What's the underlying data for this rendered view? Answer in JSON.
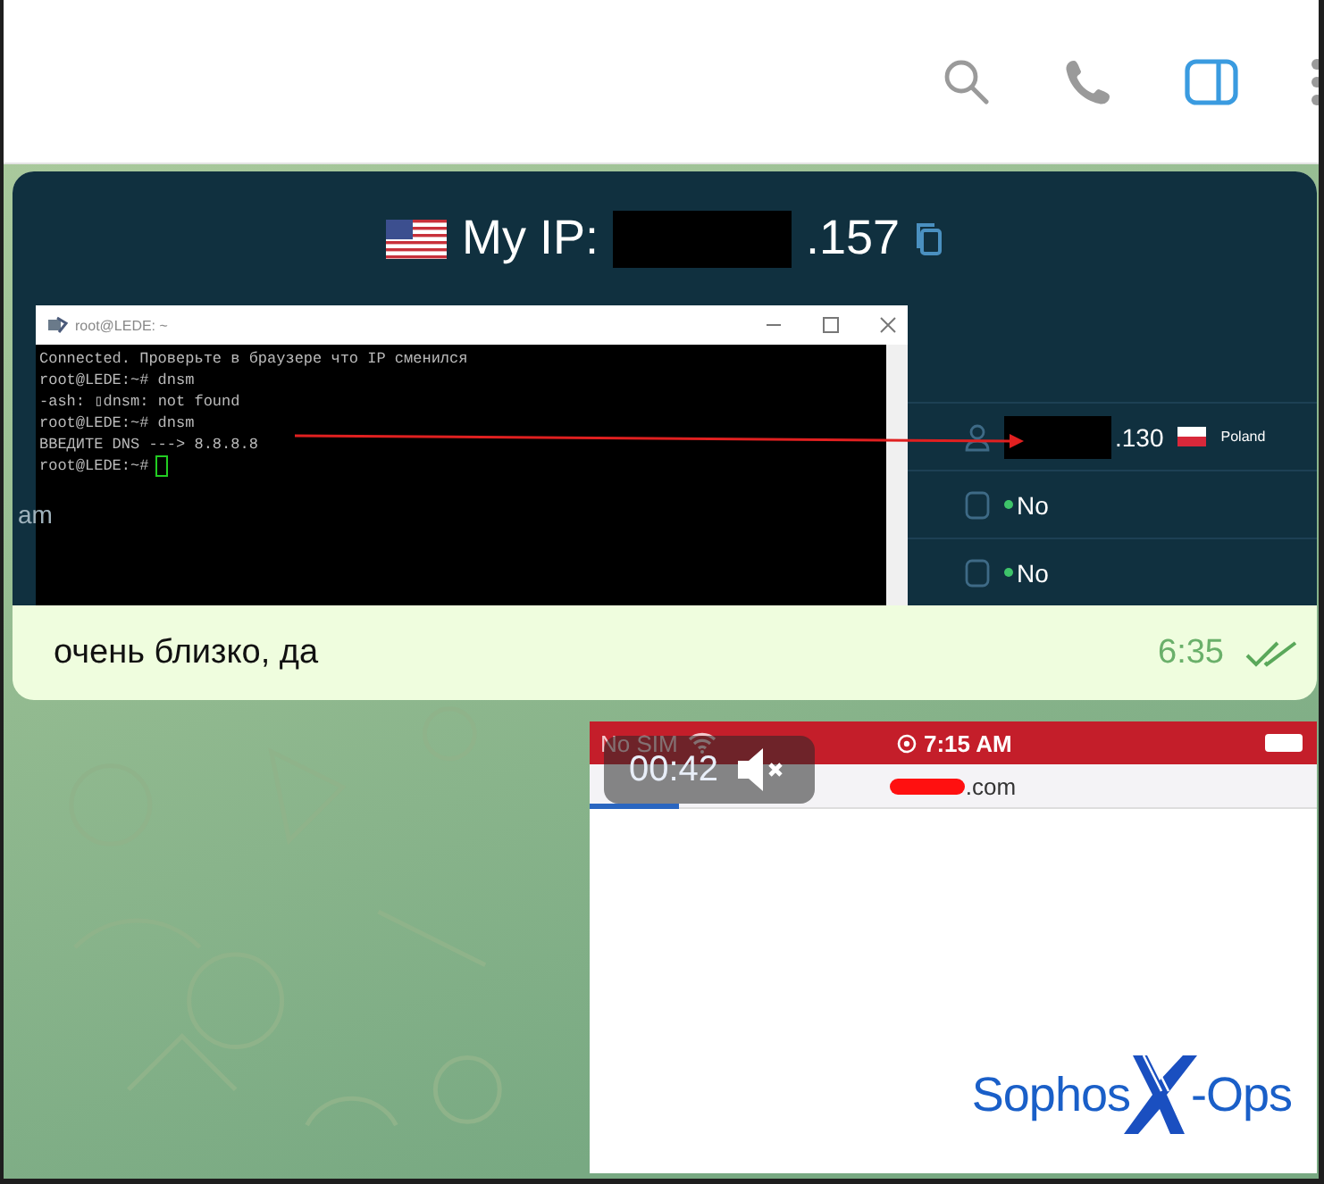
{
  "header": {
    "actions": [
      {
        "kind": "search",
        "selected": false
      },
      {
        "kind": "call",
        "selected": false
      },
      {
        "kind": "sidebar",
        "selected": true
      },
      {
        "kind": "more",
        "selected": false
      }
    ]
  },
  "side_fragment": "am",
  "message": {
    "screenshot": {
      "ip_label": "My IP:",
      "ip_suffix": ".157",
      "terminal": {
        "title": "root@LEDE: ~",
        "lines": [
          "Connected. Проверьте в браузере что IP сменился",
          "root@LEDE:~# dnsm",
          "-ash: ▯dnsm: not found",
          "root@LEDE:~# dnsm",
          "ВВЕДИТЕ DNS ---> 8.8.8.8",
          "root@LEDE:~#"
        ]
      },
      "rows": [
        {
          "kind": "ip",
          "value": ".130",
          "country": "Poland"
        },
        {
          "kind": "status",
          "value": "No"
        },
        {
          "kind": "status",
          "value": "No"
        }
      ]
    },
    "text": "очень близко, да",
    "time": "6:35",
    "read": true
  },
  "video": {
    "duration": "00:42",
    "muted": true,
    "carrier": "No SIM",
    "clock": "7:15 AM",
    "url_suffix": ".com",
    "logo": {
      "left": "Sophos",
      "right": "-Ops"
    }
  }
}
